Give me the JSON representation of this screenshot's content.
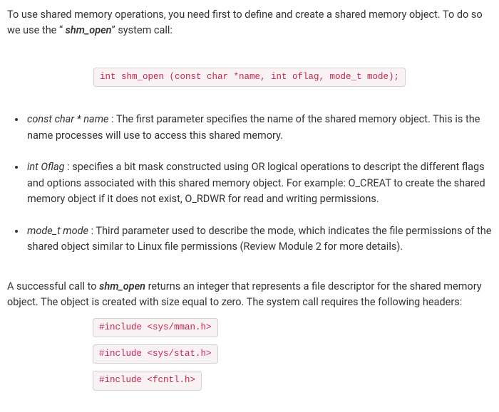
{
  "intro": {
    "pre": "To use shared memory operations, you need first to define and create a shared memory object. To do so we use the “",
    "em": " shm_open",
    "post": "” system call:"
  },
  "signature": "int shm_open (const char *name, int oflag, mode_t mode);",
  "params": [
    {
      "name": "const char * name",
      "text": " : The first parameter specifies the name of the shared memory object. This is the name processes will use to access this shared memory."
    },
    {
      "name": "int Oflag",
      "text": " : specifies a bit mask constructed using OR logical operations to descript the different flags and options associated with this shared memory object. For example: O_CREAT to create the shared memory object if it does not exist, O_RDWR for read and writing permissions."
    },
    {
      "name": "mode_t mode",
      "text": " : Third parameter used to describe the mode, which indicates the file permissions of the shared object similar to Linux file permissions (Review Module 2 for more details)."
    }
  ],
  "outro": {
    "pre": "A successful call to ",
    "em": "shm_open",
    "post": " returns an integer that represents a file descriptor for the shared memory object.  The object is created with size equal to zero. The system call requires the following headers:"
  },
  "includes": [
    "#include <sys/mman.h>",
    "#include <sys/stat.h>",
    "#include <fcntl.h>"
  ]
}
